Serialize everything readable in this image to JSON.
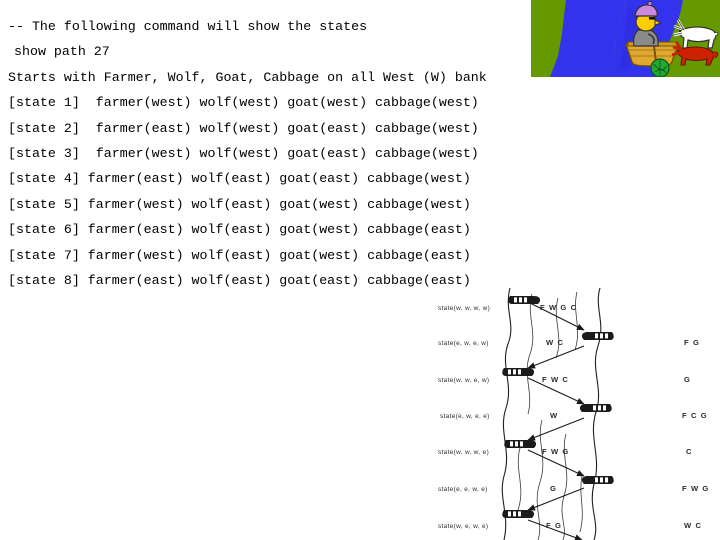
{
  "terminal": {
    "header_comment": "-- The following command will show the states",
    "command": "show path 27",
    "description": "Starts with Farmer, Wolf, Goat, Cabbage on all West (W) bank",
    "states": [
      "[state 1]  farmer(west) wolf(west) goat(west) cabbage(west)",
      "[state 2]  farmer(east) wolf(west) goat(east) cabbage(west)",
      "[state 3]  farmer(west) wolf(west) goat(east) cabbage(west)",
      "[state 4] farmer(east) wolf(east) goat(east) cabbage(west)",
      "[state 5] farmer(west) wolf(east) goat(west) cabbage(west)",
      "[state 6] farmer(east) wolf(east) goat(west) cabbage(east)",
      "[state 7] farmer(west) wolf(east) goat(west) cabbage(east)",
      "[state 8] farmer(east) wolf(east) goat(east) cabbage(east)"
    ]
  },
  "illustration": {
    "alt": "farmer rowing a boat across a blue river with goat, wolf and cabbage on the green bank",
    "colors": {
      "water": "#3333ee",
      "water_shadow": "#2222cc",
      "grass": "#669900",
      "boat": "#e0a830",
      "boat_dark": "#b07c10",
      "goat": "#ffffff",
      "wolf": "#cc2200",
      "cabbage": "#22aa33",
      "hat": "#cc88dd",
      "face": "#ffcc00",
      "shirt": "#777777"
    }
  },
  "diagram": {
    "rows": [
      {
        "state": "state(w, w, w, w)",
        "left_bank": "F W G C",
        "right_bank": ""
      },
      {
        "state": "state(e, w, e, w)",
        "left_bank": "W C",
        "right_bank": "F G"
      },
      {
        "state": "state(w, w, e, w)",
        "left_bank": "F W C",
        "right_bank": "G"
      },
      {
        "state": "state(e, w, e, e)",
        "left_bank": "W",
        "right_bank": "F C G"
      },
      {
        "state": "state(w, w, w, e)",
        "left_bank": "F W G",
        "right_bank": "C"
      },
      {
        "state": "state(e, e, w, e)",
        "left_bank": "G",
        "right_bank": "F W G"
      },
      {
        "state": "state(w, e, w, e)",
        "left_bank": "F G",
        "right_bank": "W C"
      }
    ]
  }
}
